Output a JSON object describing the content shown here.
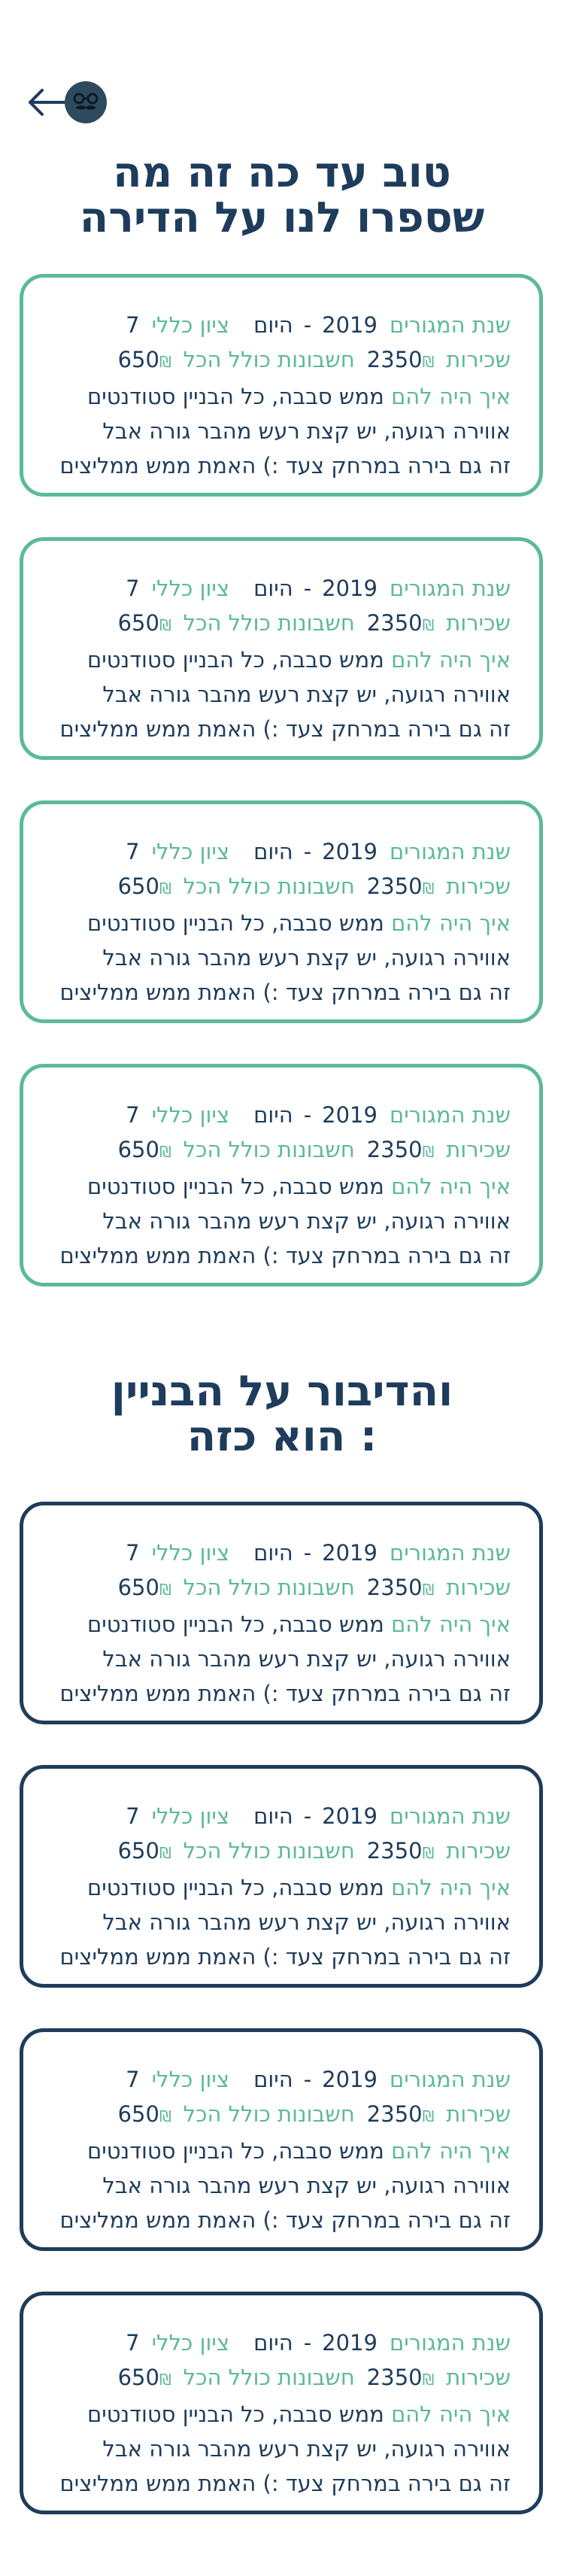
{
  "header": {
    "back_icon": "arrow-left-icon",
    "avatar_icon": "mustache-glasses-avatar-icon"
  },
  "section1": {
    "title_line1": "טוב עד כה זה מה",
    "title_line2": "שספרו לנו על הדירה"
  },
  "section2": {
    "title_line1": "והדיבור על הבניין",
    "title_line2": ": הוא כזה"
  },
  "labels": {
    "years": "שנת המגורים",
    "overall": "ציון כללי",
    "rent": "שכירות",
    "bills": "חשבונות כולל הכל",
    "how": "איך היה להם"
  },
  "colors": {
    "accent_green": "#5cb99a",
    "navy": "#1e3c5c",
    "avatar_bg": "#2e4a5f"
  },
  "apartment_reviews": [
    {
      "year_from": "2019",
      "dash": "-",
      "year_to": "היום",
      "overall_score": "7",
      "rent": "2350",
      "currency": "₪",
      "bills": "650",
      "review_line1": "ממש סבבה, כל הבניין סטודנטים",
      "review_line2": "אווירה רגועה, יש קצת רעש מהבר גורה אבל",
      "review_line3": "זה גם בירה במרחק צעד :) האמת ממש ממליצים"
    },
    {
      "year_from": "2019",
      "dash": "-",
      "year_to": "היום",
      "overall_score": "7",
      "rent": "2350",
      "currency": "₪",
      "bills": "650",
      "review_line1": "ממש סבבה, כל הבניין סטודנטים",
      "review_line2": "אווירה רגועה, יש קצת רעש מהבר גורה אבל",
      "review_line3": "זה גם בירה במרחק צעד :) האמת ממש ממליצים"
    },
    {
      "year_from": "2019",
      "dash": "-",
      "year_to": "היום",
      "overall_score": "7",
      "rent": "2350",
      "currency": "₪",
      "bills": "650",
      "review_line1": "ממש סבבה, כל הבניין סטודנטים",
      "review_line2": "אווירה רגועה, יש קצת רעש מהבר גורה אבל",
      "review_line3": "זה גם בירה במרחק צעד :) האמת ממש ממליצים"
    },
    {
      "year_from": "2019",
      "dash": "-",
      "year_to": "היום",
      "overall_score": "7",
      "rent": "2350",
      "currency": "₪",
      "bills": "650",
      "review_line1": "ממש סבבה, כל הבניין סטודנטים",
      "review_line2": "אווירה רגועה, יש קצת רעש מהבר גורה אבל",
      "review_line3": "זה גם בירה במרחק צעד :) האמת ממש ממליצים"
    }
  ],
  "building_reviews": [
    {
      "year_from": "2019",
      "dash": "-",
      "year_to": "היום",
      "overall_score": "7",
      "rent": "2350",
      "currency": "₪",
      "bills": "650",
      "review_line1": "ממש סבבה, כל הבניין סטודנטים",
      "review_line2": "אווירה רגועה, יש קצת רעש מהבר גורה אבל",
      "review_line3": "זה גם בירה במרחק צעד :) האמת ממש ממליצים"
    },
    {
      "year_from": "2019",
      "dash": "-",
      "year_to": "היום",
      "overall_score": "7",
      "rent": "2350",
      "currency": "₪",
      "bills": "650",
      "review_line1": "ממש סבבה, כל הבניין סטודנטים",
      "review_line2": "אווירה רגועה, יש קצת רעש מהבר גורה אבל",
      "review_line3": "זה גם בירה במרחק צעד :) האמת ממש ממליצים"
    },
    {
      "year_from": "2019",
      "dash": "-",
      "year_to": "היום",
      "overall_score": "7",
      "rent": "2350",
      "currency": "₪",
      "bills": "650",
      "review_line1": "ממש סבבה, כל הבניין סטודנטים",
      "review_line2": "אווירה רגועה, יש קצת רעש מהבר גורה אבל",
      "review_line3": "זה גם בירה במרחק צעד :) האמת ממש ממליצים"
    },
    {
      "year_from": "2019",
      "dash": "-",
      "year_to": "היום",
      "overall_score": "7",
      "rent": "2350",
      "currency": "₪",
      "bills": "650",
      "review_line1": "ממש סבבה, כל הבניין סטודנטים",
      "review_line2": "אווירה רגועה, יש קצת רעש מהבר גורה אבל",
      "review_line3": "זה גם בירה במרחק צעד :) האמת ממש ממליצים"
    }
  ]
}
